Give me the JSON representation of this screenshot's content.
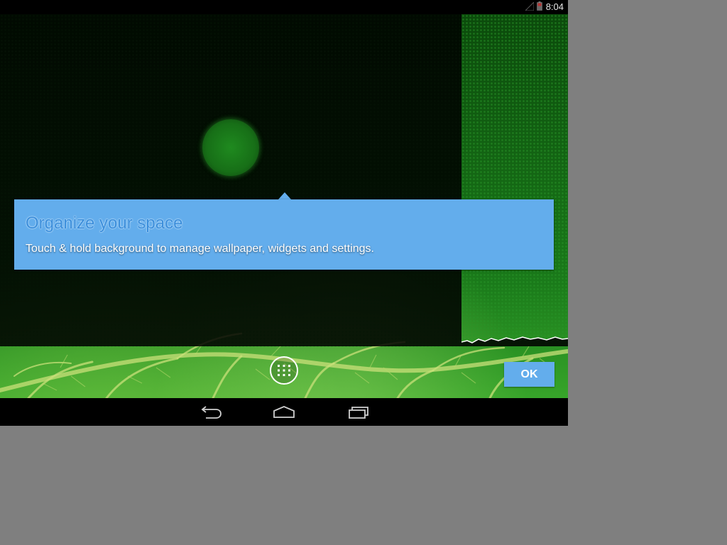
{
  "status_bar": {
    "time": "8:04",
    "signal_icon": "signal-icon",
    "battery_icon": "battery-icon"
  },
  "cling": {
    "title": "Organize your space",
    "body": "Touch & hold background to manage wallpaper, widgets and settings."
  },
  "hotseat": {
    "all_apps_icon": "apps-grid-icon"
  },
  "ok_label": "OK",
  "nav_bar": {
    "back_icon": "back-icon",
    "home_icon": "home-icon",
    "recents_icon": "recents-icon"
  },
  "colors": {
    "cling_blue": "#63adec",
    "wallpaper_green": "#1a7a1a",
    "background_gray": "#7f7f7f"
  }
}
